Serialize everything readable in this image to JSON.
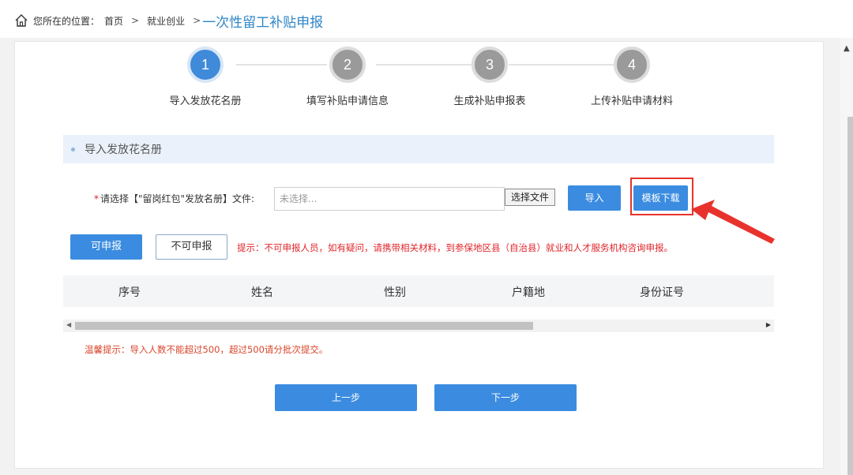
{
  "breadcrumb": {
    "prefix": "您所在的位置：",
    "home": "首页",
    "sep1": ">",
    "level2": "就业创业",
    "sep2": ">",
    "current": "一次性留工补贴申报"
  },
  "steps": [
    {
      "number": "1",
      "label": "导入发放花名册",
      "active": true
    },
    {
      "number": "2",
      "label": "填写补贴申请信息",
      "active": false
    },
    {
      "number": "3",
      "label": "生成补贴申报表",
      "active": false
    },
    {
      "number": "4",
      "label": "上传补贴申请材料",
      "active": false
    }
  ],
  "section": {
    "title": "导入发放花名册"
  },
  "file_upload": {
    "required_mark": "*",
    "label": "请选择【\"留岗红包\"发放名册】文件:",
    "placeholder": "未选择...",
    "choose_label": "选择文件",
    "import_label": "导入",
    "template_label": "模板下载"
  },
  "tabs": {
    "can_label": "可申报",
    "cannot_label": "不可申报",
    "tip": "提示：不可申报人员，如有疑问，请携带相关材料，到参保地区县（自治县）就业和人才服务机构咨询申报。"
  },
  "table": {
    "columns": [
      "序号",
      "姓名",
      "性别",
      "户籍地",
      "身份证号"
    ]
  },
  "warm_tip": "温馨提示：导入人数不能超过500，超过500请分批次提交。",
  "nav": {
    "prev_label": "上一步",
    "next_label": "下一步"
  },
  "colors": {
    "primary": "#3b8ce0",
    "step_active": "#3f8ad9",
    "step_inactive": "#9a9a9a",
    "warning_red": "#e0242a",
    "highlight": "#e8332c"
  },
  "icons": {
    "home": "home-icon",
    "arrow": "red-arrow-pointer"
  }
}
